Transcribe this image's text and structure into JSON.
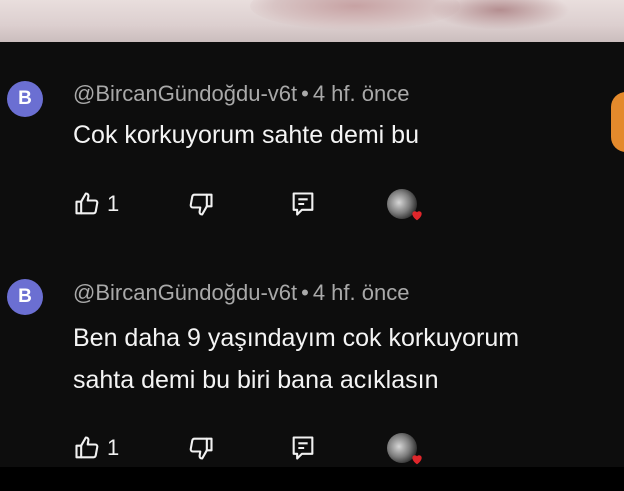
{
  "comments": [
    {
      "avatar_letter": "B",
      "author": "@BircanGündoğdu-v6t",
      "separator": "•",
      "time": "4 hf. önce",
      "lines": [
        "Cok korkuyorum sahte demi bu"
      ],
      "likes": "1"
    },
    {
      "avatar_letter": "B",
      "author": "@BircanGündoğdu-v6t",
      "separator": "•",
      "time": "4 hf. önce",
      "lines": [
        "Ben daha 9 yaşındayım cok korkuyorum",
        "sahta demi bu biri bana acıklasın"
      ],
      "likes": "1"
    }
  ],
  "icons": {
    "like": "thumbs-up-icon",
    "dislike": "thumbs-down-icon",
    "reply": "reply-comment-icon",
    "creator_heart": "creator-heart-icon"
  },
  "colors": {
    "background": "#0d0d0d",
    "avatar": "#6b6fd2",
    "meta_text": "#a9a9a9",
    "heart": "#e0262b",
    "side_badge": "#e48a2c"
  }
}
